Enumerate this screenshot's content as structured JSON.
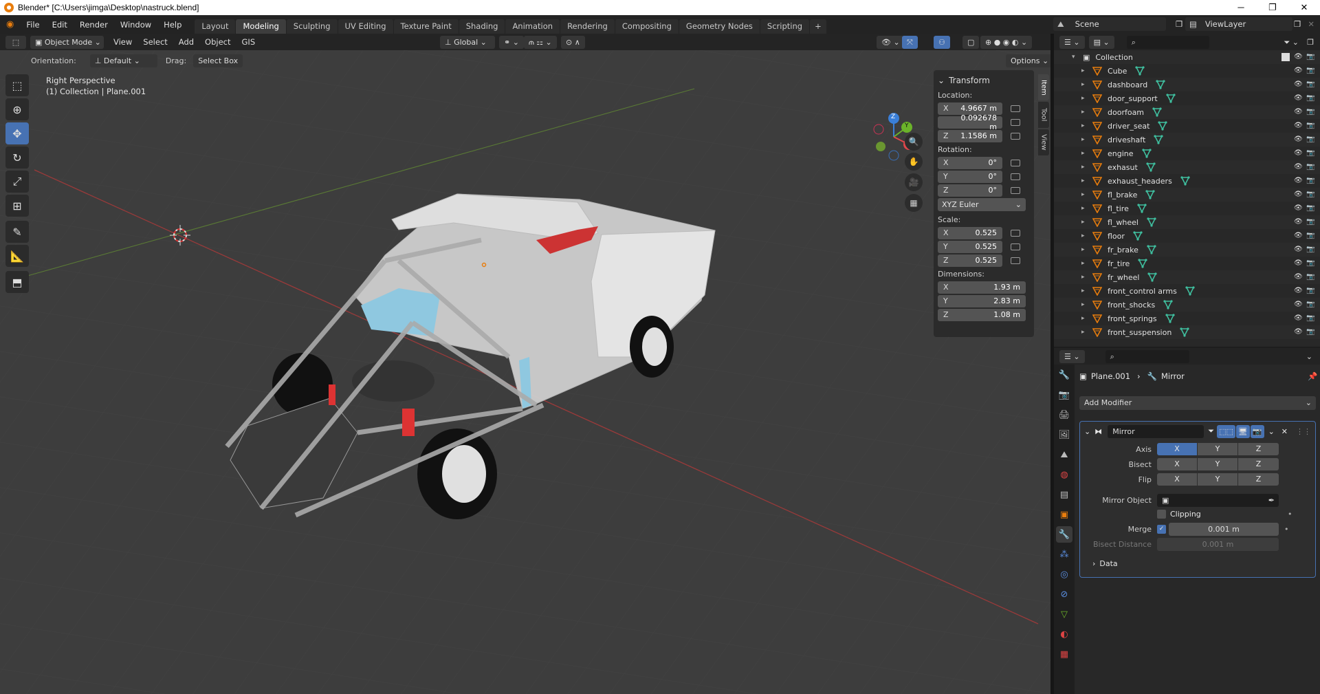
{
  "window": {
    "title": "Blender* [C:\\Users\\jimga\\Desktop\\nastruck.blend]",
    "minimize": "─",
    "maximize": "❐",
    "close": "✕"
  },
  "menu": [
    "File",
    "Edit",
    "Render",
    "Window",
    "Help"
  ],
  "workspaces": [
    "Layout",
    "Modeling",
    "Sculpting",
    "UV Editing",
    "Texture Paint",
    "Shading",
    "Animation",
    "Rendering",
    "Compositing",
    "Geometry Nodes",
    "Scripting",
    "+"
  ],
  "active_workspace": "Modeling",
  "scene": "Scene",
  "view_layer": "ViewLayer",
  "viewport": {
    "mode": "Object Mode",
    "menus": [
      "View",
      "Select",
      "Add",
      "Object",
      "GIS"
    ],
    "transform_orientation": "Global",
    "orientation_label": "Orientation:",
    "orientation_value": "Default",
    "drag_label": "Drag:",
    "drag_value": "Select Box",
    "options": "Options",
    "view_name": "Right Perspective",
    "view_sub": "(1) Collection | Plane.001"
  },
  "gizmo": {
    "x": "X",
    "y": "Y",
    "z": "Z"
  },
  "npanel": {
    "title": "Transform",
    "location_label": "Location:",
    "location": [
      {
        "axis": "X",
        "value": "4.9667 m"
      },
      {
        "axis": "",
        "value": "0.092678 m"
      },
      {
        "axis": "Z",
        "value": "1.1586 m"
      }
    ],
    "rotation_label": "Rotation:",
    "rotation": [
      {
        "axis": "X",
        "value": "0°"
      },
      {
        "axis": "Y",
        "value": "0°"
      },
      {
        "axis": "Z",
        "value": "0°"
      }
    ],
    "rotation_mode": "XYZ Euler",
    "scale_label": "Scale:",
    "scale": [
      {
        "axis": "X",
        "value": "0.525"
      },
      {
        "axis": "Y",
        "value": "0.525"
      },
      {
        "axis": "Z",
        "value": "0.525"
      }
    ],
    "dimensions_label": "Dimensions:",
    "dimensions": [
      {
        "axis": "X",
        "value": "1.93 m"
      },
      {
        "axis": "Y",
        "value": "2.83 m"
      },
      {
        "axis": "Z",
        "value": "1.08 m"
      }
    ],
    "tabs": [
      "Item",
      "Tool",
      "View"
    ]
  },
  "outliner": {
    "collection": "Collection",
    "items": [
      "Cube",
      "dashboard",
      "door_support",
      "doorfoam",
      "driver_seat",
      "driveshaft",
      "engine",
      "exhasut",
      "exhaust_headers",
      "fl_brake",
      "fl_tire",
      "fl_wheel",
      "floor",
      "fr_brake",
      "fr_tire",
      "fr_wheel",
      "front_control arms",
      "front_shocks",
      "front_springs",
      "front_suspension"
    ]
  },
  "properties": {
    "object": "Plane.001",
    "modifier_crumb": "Mirror",
    "add_modifier": "Add Modifier",
    "modifier_name": "Mirror",
    "axis_label": "Axis",
    "bisect_label": "Bisect",
    "flip_label": "Flip",
    "xyz": [
      "X",
      "Y",
      "Z"
    ],
    "mirror_object_label": "Mirror Object",
    "clipping_label": "Clipping",
    "merge_label": "Merge",
    "merge_value": "0.001 m",
    "bisect_distance_label": "Bisect Distance",
    "bisect_distance_value": "0.001 m",
    "data_label": "Data"
  },
  "colors": {
    "accent": "#4772b3",
    "orange": "#e87d0d",
    "x_axis": "#e0474b",
    "y_axis": "#6bb32a",
    "z_axis": "#3a7fd8",
    "grid": "#3d3d3d"
  }
}
